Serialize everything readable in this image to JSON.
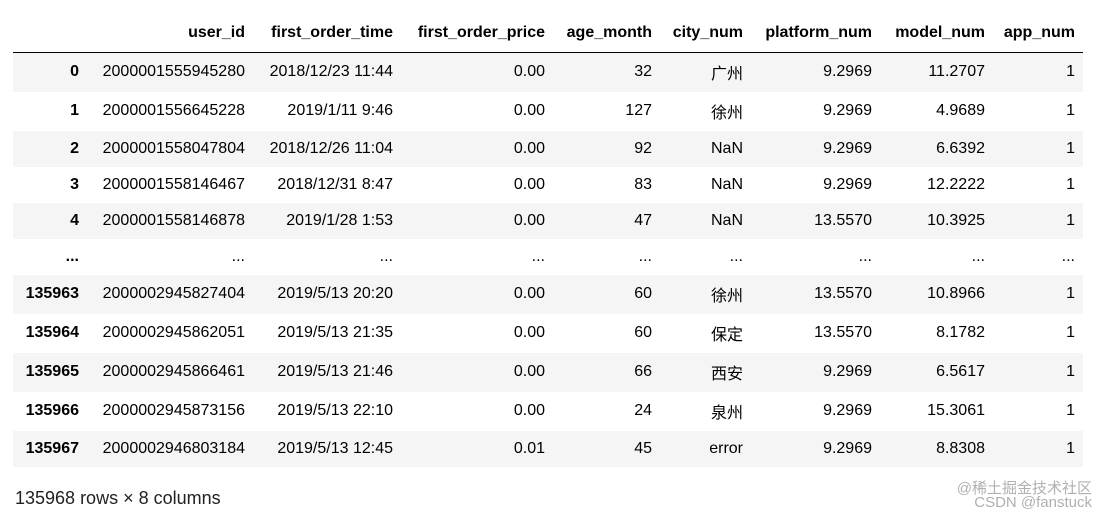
{
  "dataframe": {
    "columns": [
      "",
      "user_id",
      "first_order_time",
      "first_order_price",
      "age_month",
      "city_num",
      "platform_num",
      "model_num",
      "app_num"
    ],
    "rows": [
      [
        "0",
        "2000001555945280",
        "2018/12/23 11:44",
        "0.00",
        "32",
        "广州",
        "9.2969",
        "11.2707",
        "1"
      ],
      [
        "1",
        "2000001556645228",
        "2019/1/11 9:46",
        "0.00",
        "127",
        "徐州",
        "9.2969",
        "4.9689",
        "1"
      ],
      [
        "2",
        "2000001558047804",
        "2018/12/26 11:04",
        "0.00",
        "92",
        "NaN",
        "9.2969",
        "6.6392",
        "1"
      ],
      [
        "3",
        "2000001558146467",
        "2018/12/31 8:47",
        "0.00",
        "83",
        "NaN",
        "9.2969",
        "12.2222",
        "1"
      ],
      [
        "4",
        "2000001558146878",
        "2019/1/28 1:53",
        "0.00",
        "47",
        "NaN",
        "13.5570",
        "10.3925",
        "1"
      ],
      [
        "...",
        "...",
        "...",
        "...",
        "...",
        "...",
        "...",
        "...",
        "..."
      ],
      [
        "135963",
        "2000002945827404",
        "2019/5/13 20:20",
        "0.00",
        "60",
        "徐州",
        "13.5570",
        "10.8966",
        "1"
      ],
      [
        "135964",
        "2000002945862051",
        "2019/5/13 21:35",
        "0.00",
        "60",
        "保定",
        "13.5570",
        "8.1782",
        "1"
      ],
      [
        "135965",
        "2000002945866461",
        "2019/5/13 21:46",
        "0.00",
        "66",
        "西安",
        "9.2969",
        "6.5617",
        "1"
      ],
      [
        "135966",
        "2000002945873156",
        "2019/5/13 22:10",
        "0.00",
        "24",
        "泉州",
        "9.2969",
        "15.3061",
        "1"
      ],
      [
        "135967",
        "2000002946803184",
        "2019/5/13 12:45",
        "0.01",
        "45",
        "error",
        "9.2969",
        "8.8308",
        "1"
      ]
    ],
    "shape_text": "135968 rows × 8 columns"
  },
  "watermark": {
    "line1": "@稀土掘金技术社区",
    "line2": "CSDN @fanstuck"
  }
}
